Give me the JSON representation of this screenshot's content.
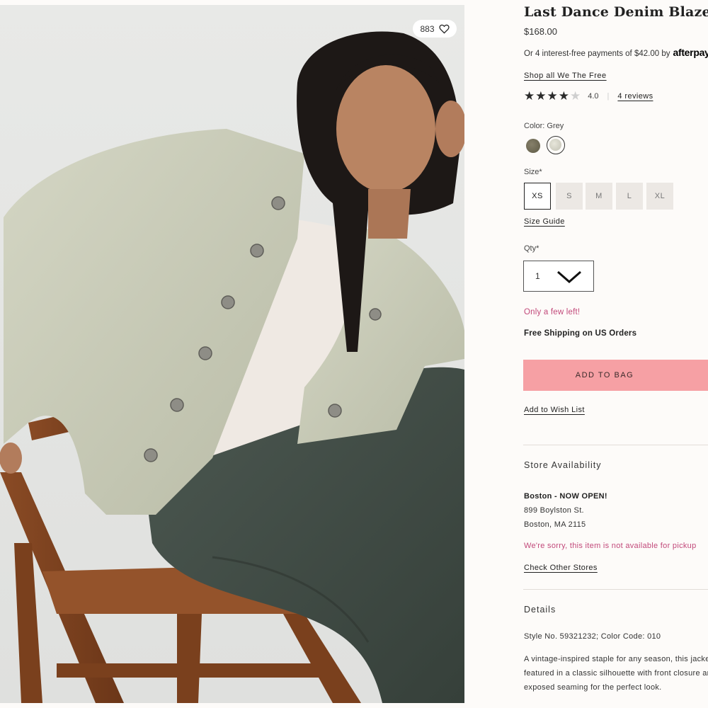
{
  "product": {
    "title": "Last Dance Denim Blazer",
    "price": "$168.00",
    "installments_text": "Or 4 interest-free payments of $42.00 by",
    "installments_brand": "afterpay",
    "shop_all_link": "Shop all We The Free",
    "rating_value": "4.0",
    "rating_stars": 4,
    "reviews_link": "4 reviews",
    "like_count": "883"
  },
  "options": {
    "color_label": "Color: Grey",
    "colors": [
      {
        "name": "olive",
        "hex": "#6f6b55"
      },
      {
        "name": "grey",
        "hex": "#d6d5c8",
        "selected": true
      }
    ],
    "size_label": "Size*",
    "sizes": [
      "XS",
      "S",
      "M",
      "L",
      "XL"
    ],
    "selected_size": "XS",
    "size_guide_link": "Size Guide",
    "qty_label": "Qty*",
    "qty_value": "1"
  },
  "status": {
    "low_stock": "Only a few left!",
    "shipping": "Free Shipping on US Orders"
  },
  "actions": {
    "add_to_bag": "ADD TO BAG",
    "wish_list": "Add to Wish List"
  },
  "store": {
    "heading": "Store Availability",
    "name": "Boston - NOW OPEN!",
    "address_line1": "899 Boylston St.",
    "address_line2": "Boston, MA 2115",
    "availability_msg": "We're sorry, this item is not available for pickup",
    "check_other_link": "Check Other Stores"
  },
  "details": {
    "heading": "Details",
    "style_line": "Style No. 59321232; Color Code: 010",
    "description": "A vintage-inspired staple for any season, this jacket is featured in a classic silhouette with front closure and exposed seaming for the perfect look."
  },
  "colors": {
    "accent_pink": "#f6a0a4",
    "alert_pink": "#c2497a",
    "background": "#fdfbf9"
  }
}
